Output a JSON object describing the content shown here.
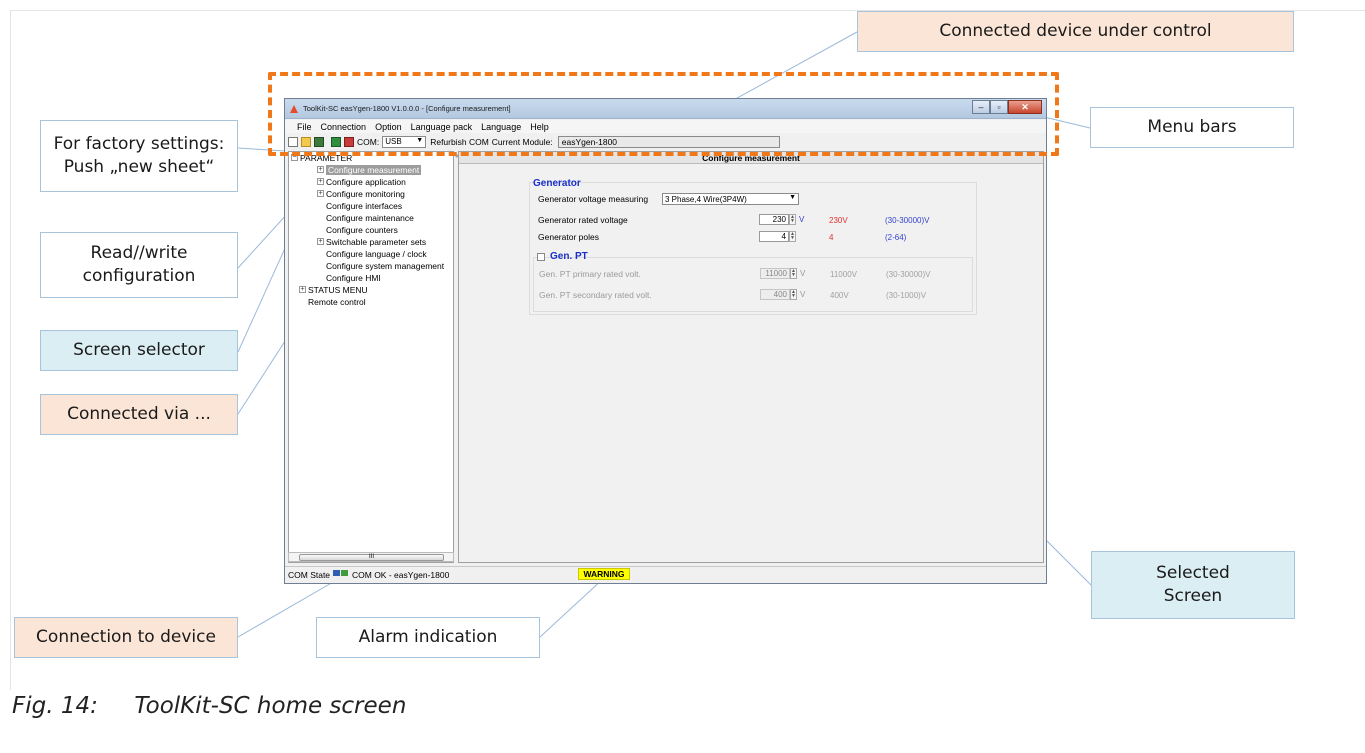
{
  "callouts": {
    "factory": "For factory settings:\nPush „new sheet“",
    "read_write": "Read//write\nconfiguration",
    "screen_selector": "Screen selector",
    "connected_via": "Connected via ...",
    "connection_to_device": "Connection to device",
    "alarm_indication": "Alarm indication",
    "connected_device": "Connected device under control",
    "menu_bars": "Menu bars",
    "selected_screen": "Selected\nScreen"
  },
  "colors": {
    "orange_dash": "#f07818",
    "peach": "#fbe5d6",
    "light_blue": "#dbeef4",
    "warning_yellow": "#ffff00"
  },
  "window": {
    "title": "ToolKit-SC easYgen-1800  V1.0.0.0 - [Configure measurement]",
    "menu": [
      "File",
      "Connection",
      "Option",
      "Language pack",
      "Language",
      "Help"
    ],
    "toolbar": {
      "com_label": "COM:",
      "com_value": "USB",
      "refurbish": "Refurbish COM",
      "current_module_label": "Current Module:",
      "current_module_value": "easYgen-1800"
    },
    "tree": {
      "root": "PARAMETER",
      "items": [
        "Configure measurement",
        "Configure application",
        "Configure monitoring",
        "Configure interfaces",
        "Configure maintenance",
        "Configure counters",
        "Switchable parameter sets",
        "Configure language / clock",
        "Configure system management",
        "Configure HMI"
      ],
      "status_menu": "STATUS MENU",
      "remote_control": "Remote control",
      "scroll_glyph": "III"
    },
    "screen": {
      "header": "Configure measurement",
      "collapse": "«",
      "generator": {
        "title": "Generator",
        "voltage_measuring_label": "Generator voltage measuring",
        "voltage_measuring_value": "3 Phase,4 Wire(3P4W)",
        "rated_voltage_label": "Generator rated voltage",
        "rated_voltage_value": "230",
        "rated_voltage_unit": "V",
        "rated_voltage_current": "230V",
        "rated_voltage_range": "(30-30000)V",
        "poles_label": "Generator poles",
        "poles_value": "4",
        "poles_current": "4",
        "poles_range": "(2-64)"
      },
      "gen_pt": {
        "title": "Gen. PT",
        "primary_label": "Gen. PT primary rated volt.",
        "primary_value": "11000",
        "primary_unit": "V",
        "primary_current": "11000V",
        "primary_range": "(30-30000)V",
        "secondary_label": "Gen. PT secondary rated volt.",
        "secondary_value": "400",
        "secondary_unit": "V",
        "secondary_current": "400V",
        "secondary_range": "(30-1000)V"
      }
    },
    "statusbar": {
      "com_state_label": "COM State",
      "com_state_value": "COM OK - easYgen-1800",
      "warning": "WARNING"
    }
  },
  "caption": "Fig. 14:     ToolKit-SC home screen"
}
